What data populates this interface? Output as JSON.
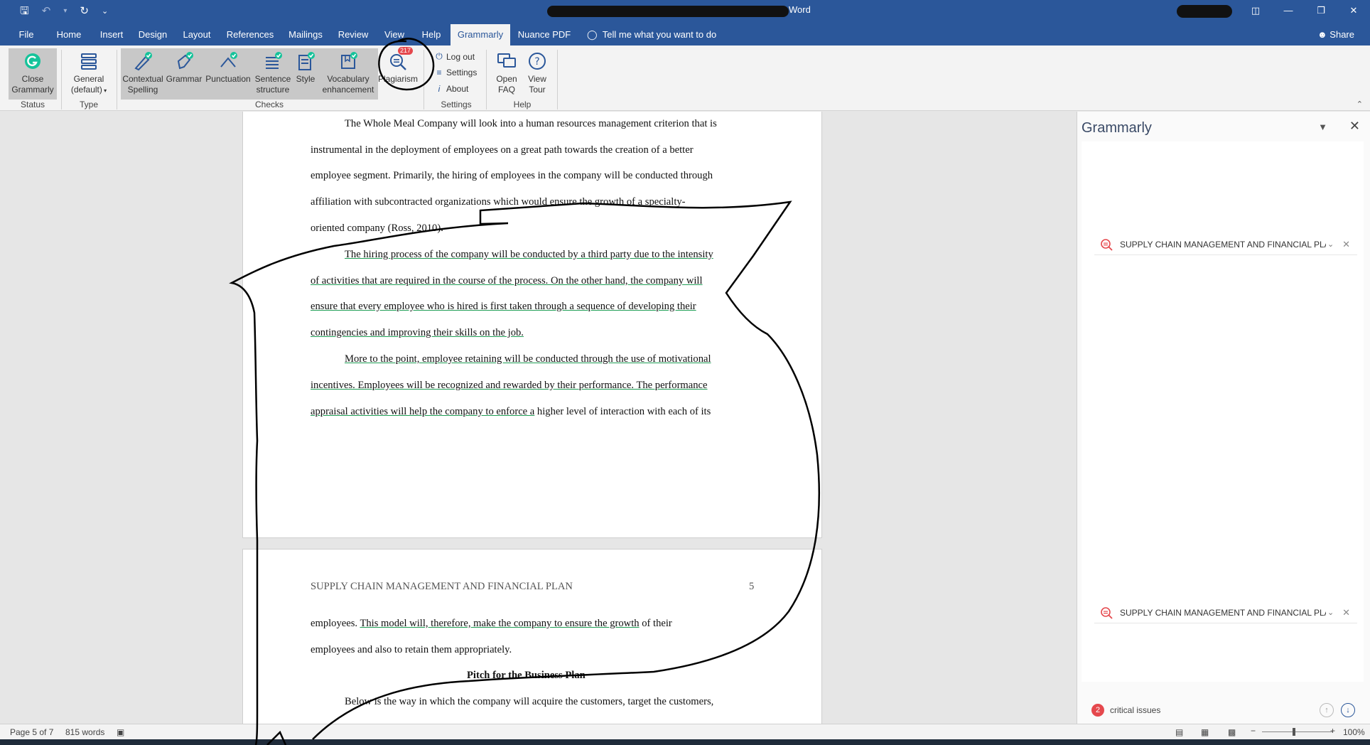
{
  "window": {
    "title": "Word",
    "controls": [
      "ribbon-display-icon",
      "minimize-icon",
      "restore-icon",
      "close-icon"
    ]
  },
  "qat": {
    "customize": "⌄"
  },
  "tabs": [
    {
      "label": "File"
    },
    {
      "label": "Home"
    },
    {
      "label": "Insert"
    },
    {
      "label": "Design"
    },
    {
      "label": "Layout"
    },
    {
      "label": "References"
    },
    {
      "label": "Mailings"
    },
    {
      "label": "Review"
    },
    {
      "label": "View"
    },
    {
      "label": "Help"
    },
    {
      "label": "Grammarly",
      "active": true
    },
    {
      "label": "Nuance PDF"
    }
  ],
  "tell_me": "Tell me what you want to do",
  "share": "Share",
  "ribbon": {
    "status": {
      "close_line1": "Close",
      "close_line2": "Grammarly",
      "group": "Status"
    },
    "type": {
      "line1": "General",
      "line2": "(default)",
      "group": "Type"
    },
    "checks": {
      "contextual_1": "Contextual",
      "contextual_2": "Spelling",
      "grammar": "Grammar",
      "punctuation": "Punctuation",
      "sentence_1": "Sentence",
      "sentence_2": "structure",
      "style": "Style",
      "vocab_1": "Vocabulary",
      "vocab_2": "enhancement",
      "plagiarism": "Plagiarism",
      "plagiarism_badge": "217",
      "group": "Checks"
    },
    "settings": {
      "logout": "Log out",
      "settings": "Settings",
      "about": "About",
      "group": "Settings"
    },
    "help": {
      "faq_1": "Open",
      "faq_2": "FAQ",
      "tour_1": "View",
      "tour_2": "Tour",
      "group": "Help"
    }
  },
  "document": {
    "page1_lines": [
      "The Whole Meal Company will look into a human resources management criterion that is",
      "instrumental in the deployment of employees on a great path towards the creation of a better",
      "employee segment. Primarily, the hiring of employees in the company will be conducted through",
      "affiliation with subcontracted organizations which would ensure the growth of a specialty-",
      "oriented company (Ross, 2010).",
      "The hiring process of the company will be conducted by a third party due to the intensity",
      "of activities that are required in the course of the process. On the other hand, the company will",
      "ensure that every employee who is hired is first taken through a sequence of developing their",
      "contingencies and improving their skills on the job.",
      " More to the point, employee retaining will be conducted through the use of motivational",
      "incentives. Employees will be recognized and rewarded by their performance. The performance",
      "appraisal activities will help the company to enforce a",
      " higher level of interaction with each of its"
    ],
    "running_head": "SUPPLY CHAIN MANAGEMENT AND FINANCIAL PLAN",
    "page_number": "5",
    "page2": {
      "l1a": "employees. ",
      "l1b": "This model will, therefore, make the company to ensure the growth",
      "l1c": " of their",
      "l2": "employees and also to retain them appropriately.",
      "heading": "Pitch for the Business Plan",
      "l3": "Below is the way in which the company will acquire the customers, target the customers,"
    }
  },
  "pane": {
    "title": "Grammarly",
    "cards": [
      {
        "text": "SUPPLY CHAIN MANAGEMENT AND FINANCIAL PLA"
      },
      {
        "text": "SUPPLY CHAIN MANAGEMENT AND FINANCIAL PLA"
      }
    ],
    "issue_count": "2",
    "issue_label": "critical issues"
  },
  "status": {
    "page": "Page 5 of 7",
    "words": "815 words",
    "zoom": "100%"
  },
  "colors": {
    "brand": "#2b579a",
    "grammarly_green": "#15c39a",
    "critical": "#e5484d"
  }
}
